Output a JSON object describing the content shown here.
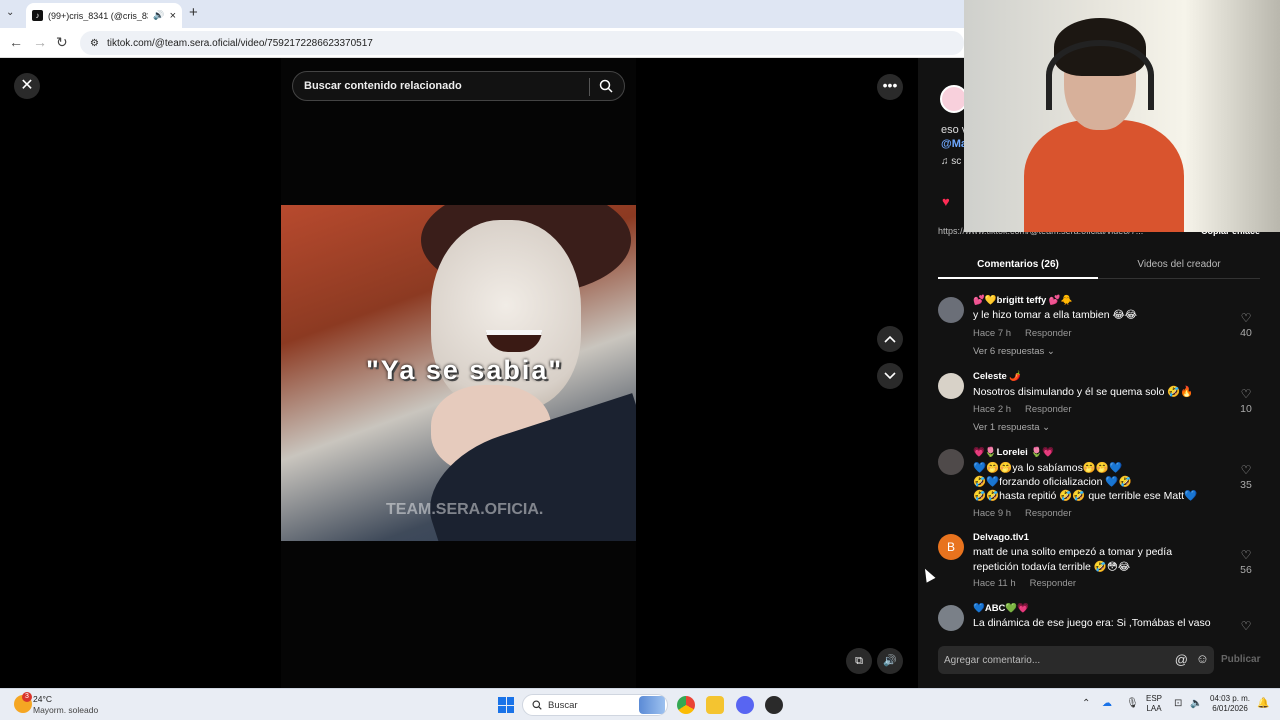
{
  "browser": {
    "tab_title": "(99+)cris_8341 (@cris_834",
    "tab_close": "×",
    "new_tab": "+",
    "url": "tiktok.com/@team.sera.oficial/video/7592172286623370517"
  },
  "video": {
    "search_placeholder": "Buscar contenido relacionado",
    "caption": "\"Ya se sabia\"",
    "watermark": "TEAM.SERA.OFICIA."
  },
  "panel": {
    "desc_line1": "eso v",
    "desc_line2": "@Ma",
    "music": "♫ sc",
    "link": "https://www.tiktok.com/@team.sera.oficial/video/7...",
    "copy_link": "Copiar enlace",
    "tab_comments": "Comentarios (26)",
    "tab_videos": "Videos del creador",
    "comment_placeholder": "Agregar comentario...",
    "publish": "Publicar"
  },
  "comments": [
    {
      "user": "💕💛brigitt teffy 💕🐥",
      "lines": [
        "y le hizo tomar a ella tambien 😂😂"
      ],
      "time": "Hace 7 h",
      "reply": "Responder",
      "replies": "Ver 6 respuestas ⌄",
      "likes": "40"
    },
    {
      "user": "Celeste 🌶️",
      "lines": [
        "Nosotros disimulando y él se quema solo 🤣🔥"
      ],
      "time": "Hace 2 h",
      "reply": "Responder",
      "replies": "Ver 1 respuesta ⌄",
      "likes": "10"
    },
    {
      "user": "💗🌷Lorelei 🌷💗",
      "lines": [
        "💙🤭🤭ya lo sabíamos🤭🤭💙",
        "🤣💙forzando oficializacion 💙🤣",
        "🤣🤣hasta repitió 🤣🤣 que terrible ese Matt💙"
      ],
      "time": "Hace 9 h",
      "reply": "Responder",
      "likes": "35"
    },
    {
      "user": "Delvago.tlv1",
      "avatar_letter": "B",
      "lines": [
        "matt de una solito empezó a tomar y pedía",
        "repetición todavía terrible 🤣😳😂"
      ],
      "time": "Hace 11 h",
      "reply": "Responder",
      "likes": "56"
    },
    {
      "user": "💙ABC💚💗",
      "lines": [
        "La dinámica de ese juego era: Si ,Tomábas el vaso"
      ]
    }
  ],
  "taskbar": {
    "weather_badge": "3",
    "weather_temp": "24°C",
    "weather_desc": "Mayorm. soleado",
    "search": "Buscar",
    "lang1": "ESP",
    "lang2": "LAA",
    "time": "04:03 p. m.",
    "date": "6/01/2026"
  },
  "colors": {
    "accent_like": "#fe2c55",
    "panel_bg": "#121212",
    "mention": "#6ea8ff"
  }
}
